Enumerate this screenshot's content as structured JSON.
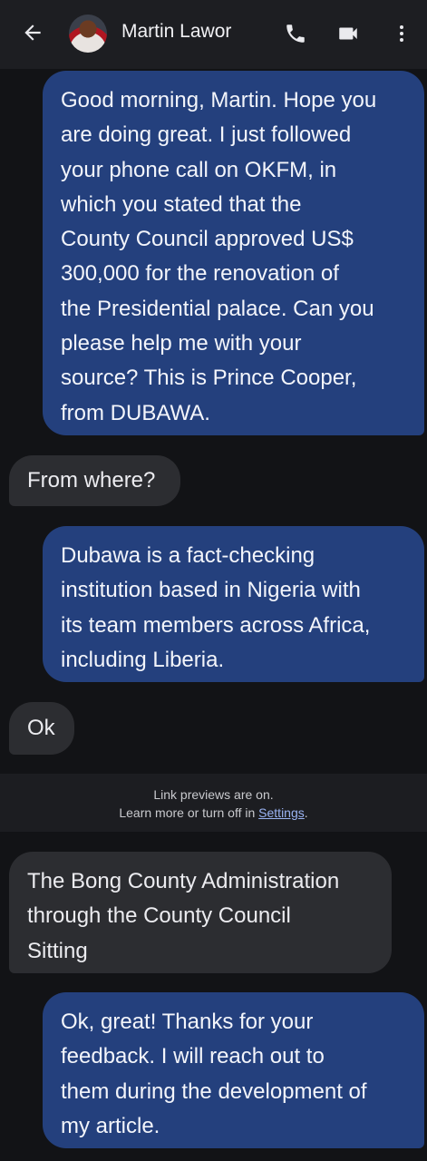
{
  "header": {
    "contact_name": "Martin Lawor",
    "back_icon": "arrow-left-icon",
    "call_icon": "phone-icon",
    "video_icon": "video-camera-icon",
    "more_icon": "more-vertical-icon"
  },
  "messages": [
    {
      "direction": "sent",
      "text": "Good morning, Martin. Hope you\nare doing great. I just followed\nyour phone call on OKFM, in\nwhich you stated that the\nCounty Council approved US$\n300,000 for the renovation of\nthe Presidential palace. Can you\nplease help me with your\nsource? This is Prince Cooper,\nfrom DUBAWA."
    },
    {
      "direction": "received",
      "text": "From where?"
    },
    {
      "direction": "sent",
      "text": "Dubawa is a fact-checking\ninstitution based in Nigeria with\nits team members across Africa,\nincluding Liberia."
    },
    {
      "direction": "received",
      "text": "Ok"
    },
    {
      "direction": "received",
      "text": "The Bong County Administration\nthrough the County Council\nSitting"
    },
    {
      "direction": "sent",
      "text": "Ok, great! Thanks for your\nfeedback. I will reach out to\nthem during the development of\nmy article."
    }
  ],
  "notice": {
    "line1": "Link previews are on.",
    "line2_prefix": "Learn more or turn off in ",
    "settings_link": "Settings",
    "line2_suffix": "."
  },
  "colors": {
    "background": "#121316",
    "header": "#1d1e22",
    "sent_bubble": "#24407d",
    "received_bubble": "#2c2d31",
    "link": "#9ab3f2"
  }
}
